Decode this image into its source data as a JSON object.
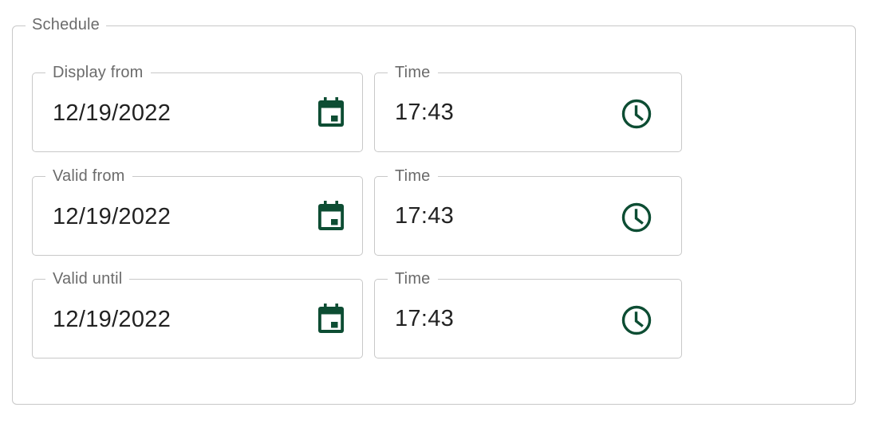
{
  "schedule": {
    "title": "Schedule",
    "accent_color": "#0d4d33",
    "rows": [
      {
        "date_label": "Display from",
        "date_value": "12/19/2022",
        "date_icon": "calendar-icon",
        "time_label": "Time",
        "time_value": "17:43",
        "time_icon": "clock-icon"
      },
      {
        "date_label": "Valid from",
        "date_value": "12/19/2022",
        "date_icon": "calendar-icon",
        "time_label": "Time",
        "time_value": "17:43",
        "time_icon": "clock-icon"
      },
      {
        "date_label": "Valid until",
        "date_value": "12/19/2022",
        "date_icon": "calendar-icon",
        "time_label": "Time",
        "time_value": "17:43",
        "time_icon": "clock-icon"
      }
    ]
  }
}
